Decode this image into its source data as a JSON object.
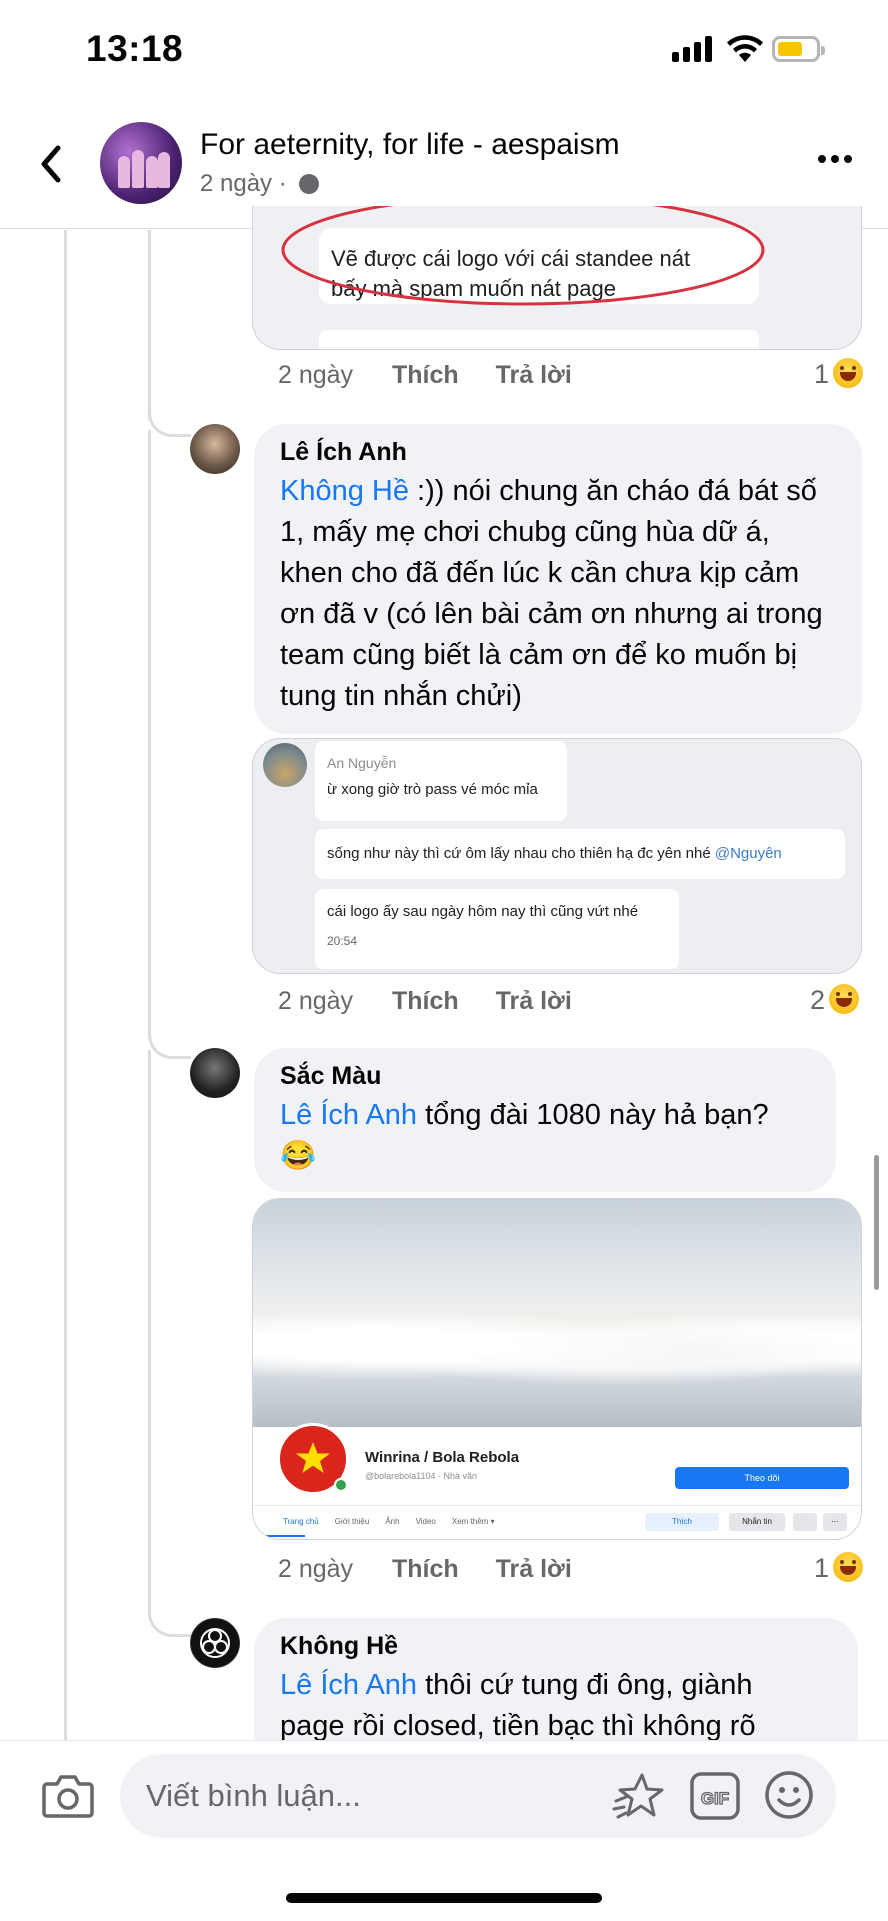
{
  "status": {
    "time": "13:18"
  },
  "header": {
    "title": "For aeternity, for life - aespaism",
    "meta": "2 ngày ·"
  },
  "actions": {
    "like": "Thích",
    "reply": "Trả lời"
  },
  "top_attachment": {
    "text_line1": "Vẽ được cái logo với cái standee nát",
    "text_line2": "bấy mà spam muốn nát page",
    "time": "2 ngày",
    "reaction_count": "1"
  },
  "comments": [
    {
      "author": "Lê Ích Anh",
      "mention": "Không Hề",
      "text": " :)) nói chung ăn cháo đá bát số 1, mấy mẹ chơi chubg cũng hùa dữ á, khen cho đã đến lúc k cần chưa kịp cảm ơn đã v (có lên bài cảm ơn nhưng ai trong team cũng biết là cảm ơn để ko muốn bị tung tin nhắn chửi)",
      "time": "2 ngày",
      "reaction_count": "2",
      "attachment": {
        "sender": "An Nguyễn",
        "msg1": "ừ xong giờ trò pass vé móc mỉa",
        "msg2": "sống như này thì cứ ôm lấy nhau cho thiên hạ đc yên nhé ",
        "msg2_mention": "@Nguyên",
        "msg3": "cái logo ấy sau ngày hôm nay thì cũng vứt nhé",
        "msg3_time": "20:54"
      }
    },
    {
      "author": "Sắc Màu",
      "mention": "Lê Ích Anh",
      "text": " tổng đài 1080 này hả bạn?",
      "emoji": "😂",
      "time": "2 ngày",
      "reaction_count": "1",
      "attachment": {
        "page_name": "Winrina / Bola Rebola",
        "page_handle": "@bolarebola1104 · Nhà văn",
        "follow_btn": "Theo dõi",
        "tabs": [
          "Trang chủ",
          "Giới thiệu",
          "Ảnh",
          "Video",
          "Xem thêm ▾"
        ],
        "like_btn": "Thích",
        "message_btn": "Nhắn tin",
        "more": "···"
      }
    },
    {
      "author": "Không Hề",
      "mention": "Lê Ích Anh",
      "text_line1": " thôi cứ tung đi ông, giành",
      "text_line2": "page rồi closed, tiền bạc thì không rõ"
    }
  ],
  "composer": {
    "placeholder": "Viết bình luận..."
  },
  "colors": {
    "mention": "#1877f2",
    "bubble": "#f0f2f5",
    "secondary_text": "#65676b",
    "battery": "#f7c600"
  }
}
